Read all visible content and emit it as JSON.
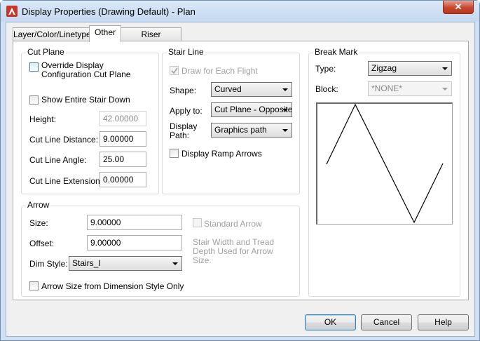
{
  "window": {
    "title": "Display Properties (Drawing Default) - Plan",
    "close_symbol": "✕",
    "icon": "autocad-icon",
    "accent": "#c7462c"
  },
  "tabs": [
    {
      "label": "Layer/Color/Linetype",
      "active": false
    },
    {
      "label": "Other",
      "active": true
    },
    {
      "label": "Riser Numbering",
      "active": false
    }
  ],
  "cut_plane": {
    "title": "Cut Plane",
    "override_label": "Override Display Configuration Cut Plane",
    "override_checked": false,
    "show_entire_label": "Show Entire Stair Down",
    "show_entire_checked": false,
    "height_label": "Height:",
    "height_value": "42.00000",
    "cut_line_distance_label": "Cut Line Distance:",
    "cut_line_distance_value": "9.00000",
    "cut_line_angle_label": "Cut Line Angle:",
    "cut_line_angle_value": "25.00",
    "cut_line_extension_label": "Cut Line Extension:",
    "cut_line_extension_value": "0.00000"
  },
  "stair_line": {
    "title": "Stair Line",
    "draw_each_flight_label": "Draw for Each Flight",
    "draw_each_flight_checked": true,
    "shape_label": "Shape:",
    "shape_value": "Curved",
    "apply_to_label": "Apply to:",
    "apply_to_value": "Cut Plane - Opposite",
    "display_path_label_1": "Display",
    "display_path_label_2": "Path:",
    "display_path_value": "Graphics path",
    "display_ramp_arrows_label": "Display Ramp Arrows",
    "display_ramp_arrows_checked": false
  },
  "break_mark": {
    "title": "Break Mark",
    "type_label": "Type:",
    "type_value": "Zigzag",
    "block_label": "Block:",
    "block_value": "*NONE*"
  },
  "arrow": {
    "title": "Arrow",
    "size_label": "Size:",
    "size_value": "9.00000",
    "offset_label": "Offset:",
    "offset_value": "9.00000",
    "dim_style_label": "Dim Style:",
    "dim_style_value": "Stairs_I",
    "arrow_size_from_dim_label": "Arrow Size from Dimension Style Only",
    "arrow_size_from_dim_checked": false,
    "standard_arrow_label": "Standard Arrow",
    "standard_arrow_checked": false,
    "note_line_1": "Stair Width and Tread",
    "note_line_2": "Depth Used for Arrow",
    "note_line_3": "Size."
  },
  "buttons": {
    "ok": "OK",
    "cancel": "Cancel",
    "help": "Help"
  }
}
